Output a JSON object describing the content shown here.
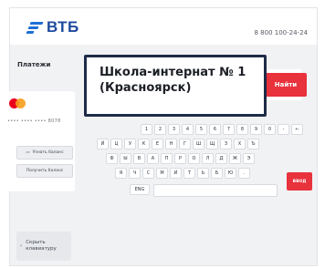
{
  "header": {
    "logo_text": "ВТБ",
    "phone": "8 800 100-24-24"
  },
  "section_title": "Платежи",
  "card": {
    "number_masked": "•••• •••• •••• 8078",
    "brand_icon": "mastercard-icon",
    "actions": [
      {
        "label": "Узнать баланс",
        "icon": "print-icon"
      },
      {
        "label": "Получить баланс"
      }
    ]
  },
  "find_button_label": "Найти",
  "keyboard": {
    "rows": [
      [
        "1",
        "2",
        "3",
        "4",
        "5",
        "6",
        "7",
        "8",
        "9",
        "0",
        "-",
        "←"
      ],
      [
        "Й",
        "Ц",
        "У",
        "К",
        "Е",
        "Н",
        "Г",
        "Ш",
        "Щ",
        "З",
        "Х",
        "Ъ"
      ],
      [
        "Ф",
        "Ы",
        "В",
        "А",
        "П",
        "Р",
        "О",
        "Л",
        "Д",
        "Ж",
        "Э"
      ],
      [
        "Я",
        "Ч",
        "С",
        "М",
        "И",
        "Т",
        "Ь",
        "Б",
        "Ю",
        "."
      ]
    ],
    "lang_label": "ENG",
    "enter_label": "ВВОД"
  },
  "hide_keyboard": {
    "arrow": "‹",
    "label_line1": "Скрыть",
    "label_line2": "клавиатуру"
  },
  "popup": {
    "line1": "Школа-интернат № 1",
    "line2": "(Красноярск)"
  },
  "colors": {
    "brand_blue": "#1f4b9e",
    "accent_red": "#e8323c",
    "popup_border": "#1e2c48"
  }
}
